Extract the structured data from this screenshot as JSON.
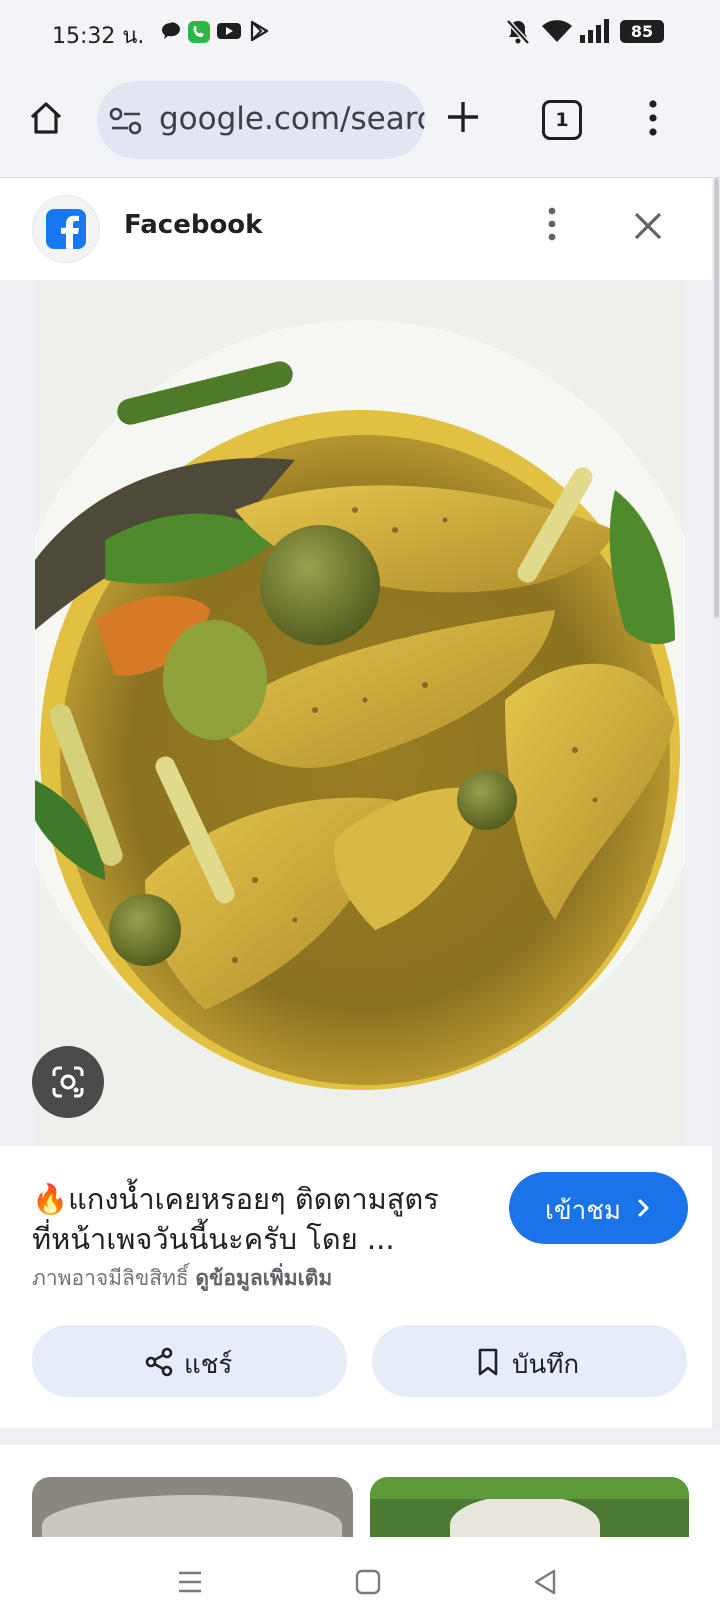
{
  "status_bar": {
    "time": "15:32 น.",
    "battery": "85",
    "icons": [
      "chat-icon",
      "phone-call-icon",
      "youtube-icon",
      "play-store-icon",
      "bell-muted-icon",
      "wifi-icon",
      "signal-icon",
      "battery-icon"
    ]
  },
  "browser": {
    "url": "google.com/search",
    "tab_count": "1",
    "icons": [
      "home-icon",
      "site-settings-icon",
      "new-tab-icon",
      "tab-switcher-icon",
      "more-vert-icon"
    ]
  },
  "sheet": {
    "source_name": "Facebook",
    "title_line1": "🔥แกงน้ำเคยหรอยๆ ติดตามสูตร",
    "title_line2": "ที่หน้าเพจวันนี้นะครับ โดย ...",
    "rights_text": "ภาพอาจมีลิขสิทธิ์",
    "rights_link": "ดูข้อมูลเพิ่มเติม",
    "visit_label": "เข้าชม",
    "share_label": "แชร์",
    "save_label": "บันทึก"
  },
  "colors": {
    "accent": "#1a73e8",
    "omnibox": "#e2e6f3",
    "pill": "#e6ecf8",
    "facebook": "#1877f2",
    "curry": "#8c7321"
  }
}
